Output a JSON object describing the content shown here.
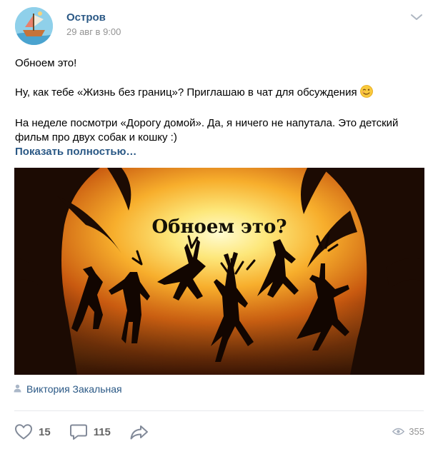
{
  "post": {
    "group_name": "Остров",
    "date": "29 авг в 9:00",
    "paragraphs": [
      "Обноем это!",
      "Ну, как тебе «Жизнь без границ»? Приглашаю в чат для обсуждения",
      "На неделе посмотри «Дорогу домой». Да, я ничего не напутала. Это детский фильм про двух собак и кошку :)"
    ],
    "emoji": "wink-emoji",
    "show_more_label": "Показать полностью…",
    "image_caption": "Обноем это?",
    "author": "Виктория Закальная"
  },
  "actions": {
    "likes": "15",
    "comments": "115",
    "views": "355"
  },
  "icons": {
    "more": "chevron-down-icon",
    "author": "user-icon",
    "like": "heart-icon",
    "comment": "comment-icon",
    "share": "share-icon",
    "views": "eye-icon"
  },
  "colors": {
    "link": "#2a5885",
    "meta": "#939393",
    "icon": "#828a99",
    "divider": "#e7e8ec"
  }
}
